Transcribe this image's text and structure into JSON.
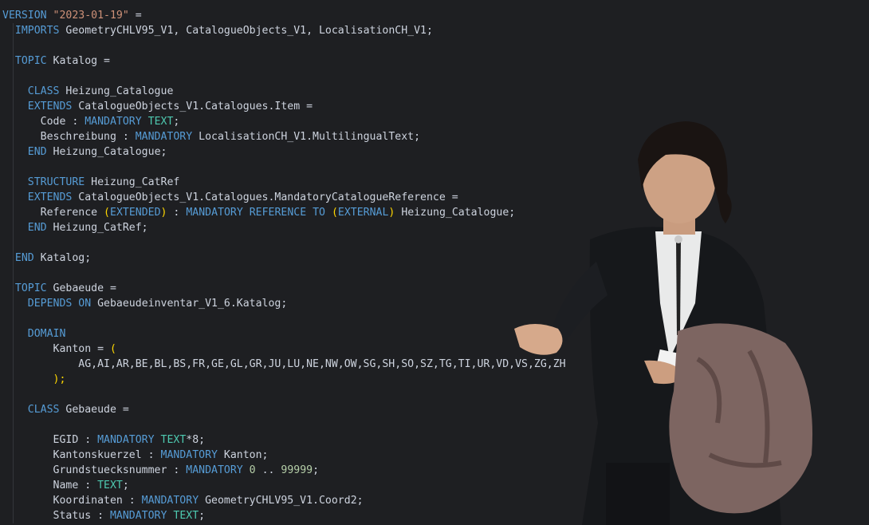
{
  "editor": {
    "lines": [
      [
        {
          "t": "VERSION ",
          "c": "kw"
        },
        {
          "t": "\"2023-01-19\"",
          "c": "st"
        },
        {
          "t": " =",
          "c": "tx"
        }
      ],
      [
        {
          "t": "  ",
          "c": "tx"
        },
        {
          "t": "IMPORTS",
          "c": "kw"
        },
        {
          "t": " GeometryCHLV95_V1, CatalogueObjects_V1, LocalisationCH_V1;",
          "c": "tx"
        }
      ],
      [],
      [
        {
          "t": "  ",
          "c": "tx"
        },
        {
          "t": "TOPIC",
          "c": "kw"
        },
        {
          "t": " Katalog =",
          "c": "tx"
        }
      ],
      [],
      [
        {
          "t": "    ",
          "c": "tx"
        },
        {
          "t": "CLASS",
          "c": "kw"
        },
        {
          "t": " Heizung_Catalogue",
          "c": "tx"
        }
      ],
      [
        {
          "t": "    ",
          "c": "tx"
        },
        {
          "t": "EXTENDS",
          "c": "kw"
        },
        {
          "t": " CatalogueObjects_V1.Catalogues.Item =",
          "c": "tx"
        }
      ],
      [
        {
          "t": "      Code : ",
          "c": "tx"
        },
        {
          "t": "MANDATORY",
          "c": "kw"
        },
        {
          "t": " ",
          "c": "tx"
        },
        {
          "t": "TEXT",
          "c": "ty"
        },
        {
          "t": ";",
          "c": "tx"
        }
      ],
      [
        {
          "t": "      Beschreibung : ",
          "c": "tx"
        },
        {
          "t": "MANDATORY",
          "c": "kw"
        },
        {
          "t": " LocalisationCH_V1.MultilingualText;",
          "c": "tx"
        }
      ],
      [
        {
          "t": "    ",
          "c": "tx"
        },
        {
          "t": "END",
          "c": "kw"
        },
        {
          "t": " Heizung_Catalogue;",
          "c": "tx"
        }
      ],
      [],
      [
        {
          "t": "    ",
          "c": "tx"
        },
        {
          "t": "STRUCTURE",
          "c": "kw"
        },
        {
          "t": " Heizung_CatRef",
          "c": "tx"
        }
      ],
      [
        {
          "t": "    ",
          "c": "tx"
        },
        {
          "t": "EXTENDS",
          "c": "kw"
        },
        {
          "t": " CatalogueObjects_V1.Catalogues.MandatoryCatalogueReference =",
          "c": "tx"
        }
      ],
      [
        {
          "t": "      Reference ",
          "c": "tx"
        },
        {
          "t": "(",
          "c": "pa"
        },
        {
          "t": "EXTENDED",
          "c": "kw"
        },
        {
          "t": ")",
          "c": "pa"
        },
        {
          "t": " : ",
          "c": "tx"
        },
        {
          "t": "MANDATORY REFERENCE TO",
          "c": "kw"
        },
        {
          "t": " ",
          "c": "tx"
        },
        {
          "t": "(",
          "c": "pa"
        },
        {
          "t": "EXTERNAL",
          "c": "kw"
        },
        {
          "t": ")",
          "c": "pa"
        },
        {
          "t": " Heizung_Catalogue;",
          "c": "tx"
        }
      ],
      [
        {
          "t": "    ",
          "c": "tx"
        },
        {
          "t": "END",
          "c": "kw"
        },
        {
          "t": " Heizung_CatRef;",
          "c": "tx"
        }
      ],
      [],
      [
        {
          "t": "  ",
          "c": "tx"
        },
        {
          "t": "END",
          "c": "kw"
        },
        {
          "t": " Katalog;",
          "c": "tx"
        }
      ],
      [],
      [
        {
          "t": "  ",
          "c": "tx"
        },
        {
          "t": "TOPIC",
          "c": "kw"
        },
        {
          "t": " Gebaeude =",
          "c": "tx"
        }
      ],
      [
        {
          "t": "    ",
          "c": "tx"
        },
        {
          "t": "DEPENDS ON",
          "c": "kw"
        },
        {
          "t": " Gebaeudeinventar_V1_6.Katalog;",
          "c": "tx"
        }
      ],
      [],
      [
        {
          "t": "    ",
          "c": "tx"
        },
        {
          "t": "DOMAIN",
          "c": "kw"
        }
      ],
      [
        {
          "t": "        Kanton = ",
          "c": "tx"
        },
        {
          "t": "(",
          "c": "pa"
        }
      ],
      [
        {
          "t": "            AG,AI,AR,BE,BL,BS,FR,GE,GL,GR,JU,LU,NE,NW,OW,SG,SH,SO,SZ,TG,TI,UR,VD,VS,ZG,ZH",
          "c": "tx"
        }
      ],
      [
        {
          "t": "        ",
          "c": "tx"
        },
        {
          "t": ");",
          "c": "pa"
        }
      ],
      [],
      [
        {
          "t": "    ",
          "c": "tx"
        },
        {
          "t": "CLASS",
          "c": "kw"
        },
        {
          "t": " Gebaeude =",
          "c": "tx"
        }
      ],
      [],
      [
        {
          "t": "        EGID : ",
          "c": "tx"
        },
        {
          "t": "MANDATORY",
          "c": "kw"
        },
        {
          "t": " ",
          "c": "tx"
        },
        {
          "t": "TEXT",
          "c": "ty"
        },
        {
          "t": "*8;",
          "c": "tx"
        }
      ],
      [
        {
          "t": "        Kantonskuerzel : ",
          "c": "tx"
        },
        {
          "t": "MANDATORY",
          "c": "kw"
        },
        {
          "t": " Kanton;",
          "c": "tx"
        }
      ],
      [
        {
          "t": "        Grundstuecksnummer : ",
          "c": "tx"
        },
        {
          "t": "MANDATORY",
          "c": "kw"
        },
        {
          "t": " ",
          "c": "tx"
        },
        {
          "t": "0",
          "c": "nm"
        },
        {
          "t": " .. ",
          "c": "tx"
        },
        {
          "t": "99999",
          "c": "nm"
        },
        {
          "t": ";",
          "c": "tx"
        }
      ],
      [
        {
          "t": "        Name : ",
          "c": "tx"
        },
        {
          "t": "TEXT",
          "c": "ty"
        },
        {
          "t": ";",
          "c": "tx"
        }
      ],
      [
        {
          "t": "        Koordinaten : ",
          "c": "tx"
        },
        {
          "t": "MANDATORY",
          "c": "kw"
        },
        {
          "t": " GeometryCHLV95_V1.Coord2;",
          "c": "tx"
        }
      ],
      [
        {
          "t": "        Status : ",
          "c": "tx"
        },
        {
          "t": "MANDATORY",
          "c": "kw"
        },
        {
          "t": " ",
          "c": "tx"
        },
        {
          "t": "TEXT",
          "c": "ty"
        },
        {
          "t": ";",
          "c": "tx"
        }
      ]
    ]
  },
  "overlay": {
    "icon": "confused-man-meme-cutout"
  }
}
